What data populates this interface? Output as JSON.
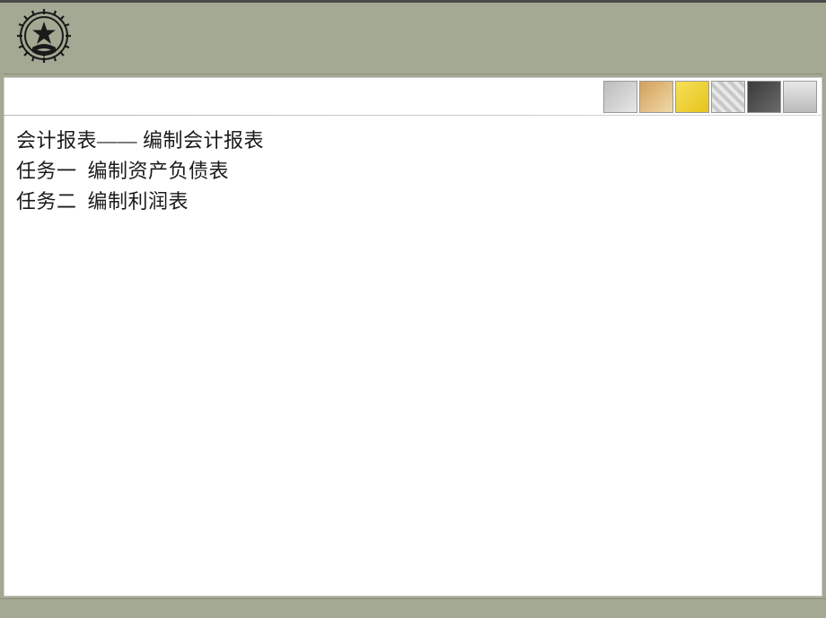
{
  "slide": {
    "title_line": "会计报表—— 编制会计报表",
    "task1": "任务一  编制资产负债表",
    "task2": "任务二  编制利润表"
  }
}
